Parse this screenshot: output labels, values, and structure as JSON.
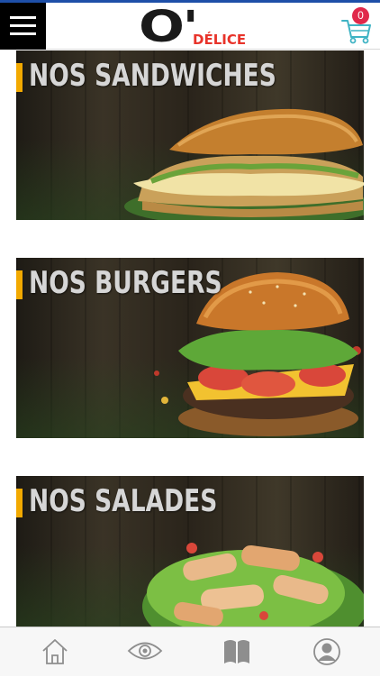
{
  "app": {
    "logo_text": "O'",
    "logo_subtext": "DÉLICE",
    "menu_icon": "hamburger-menu-icon",
    "cart_icon": "shopping-cart-icon",
    "cart_count": "0"
  },
  "categories": [
    {
      "title": "NOS SANDWICHES",
      "image": "sandwich-image"
    },
    {
      "title": "NOS BURGERS",
      "image": "burger-image"
    },
    {
      "title": "NOS SALADES",
      "image": "salad-image"
    }
  ],
  "tabbar": [
    {
      "icon": "home-icon"
    },
    {
      "icon": "eye-icon"
    },
    {
      "icon": "book-icon"
    },
    {
      "icon": "user-profile-icon"
    }
  ],
  "colors": {
    "accent": "#f2a900",
    "brand_red": "#e8332a",
    "badge": "#e0294b",
    "cart": "#3fb3c4",
    "top_line": "#1e4fa8"
  }
}
